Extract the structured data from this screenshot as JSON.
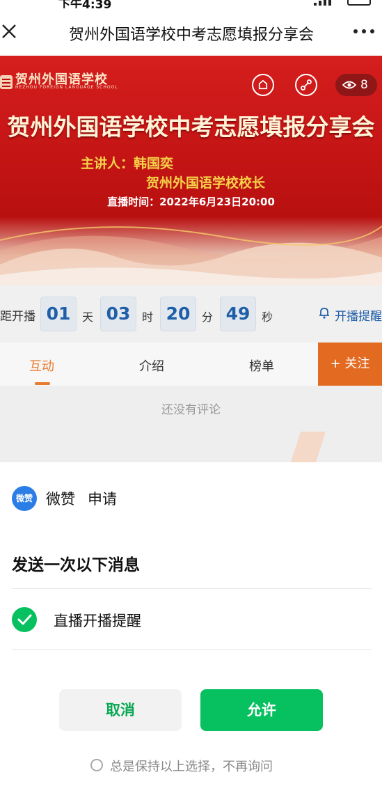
{
  "status_bar": {
    "time": "下午4:39"
  },
  "nav": {
    "title": "贺州外国语学校中考志愿填报分享会"
  },
  "banner": {
    "logo_text": "贺州外国语学校",
    "logo_sub": "HEZHOU FOREIGN LANGUAGE SCHOOL",
    "views": "8",
    "title": "贺州外国语学校中考志愿填报分享会",
    "speaker_line1": "主讲人：韩国奕",
    "speaker_line2": "贺州外国语学校校长",
    "live_time": "直播时间：2022年6月23日20:00"
  },
  "countdown": {
    "label": "距开播",
    "days": "01",
    "days_unit": "天",
    "hours": "03",
    "hours_unit": "时",
    "minutes": "20",
    "minutes_unit": "分",
    "seconds": "49",
    "seconds_unit": "秒",
    "remind": "开播提醒"
  },
  "tabs": [
    {
      "label": "互动",
      "active": true
    },
    {
      "label": "介绍",
      "active": false
    },
    {
      "label": "榜单",
      "active": false
    }
  ],
  "follow_label": "+ 关注",
  "comments": {
    "empty_text": "还没有评论"
  },
  "sheet": {
    "app_icon_text": "微赞",
    "app_name": "微赞",
    "app_action": "申请",
    "title": "发送一次以下消息",
    "option_label": "直播开播提醒",
    "cancel_label": "取消",
    "allow_label": "允许",
    "keep_choice_text": "总是保持以上选择，不再询问"
  },
  "colors": {
    "accent_green": "#07c160",
    "tab_active": "#e87a2c",
    "follow_bg": "#e36a21",
    "countdown_blue": "#1f5fa8",
    "banner_red": "#c61515"
  }
}
